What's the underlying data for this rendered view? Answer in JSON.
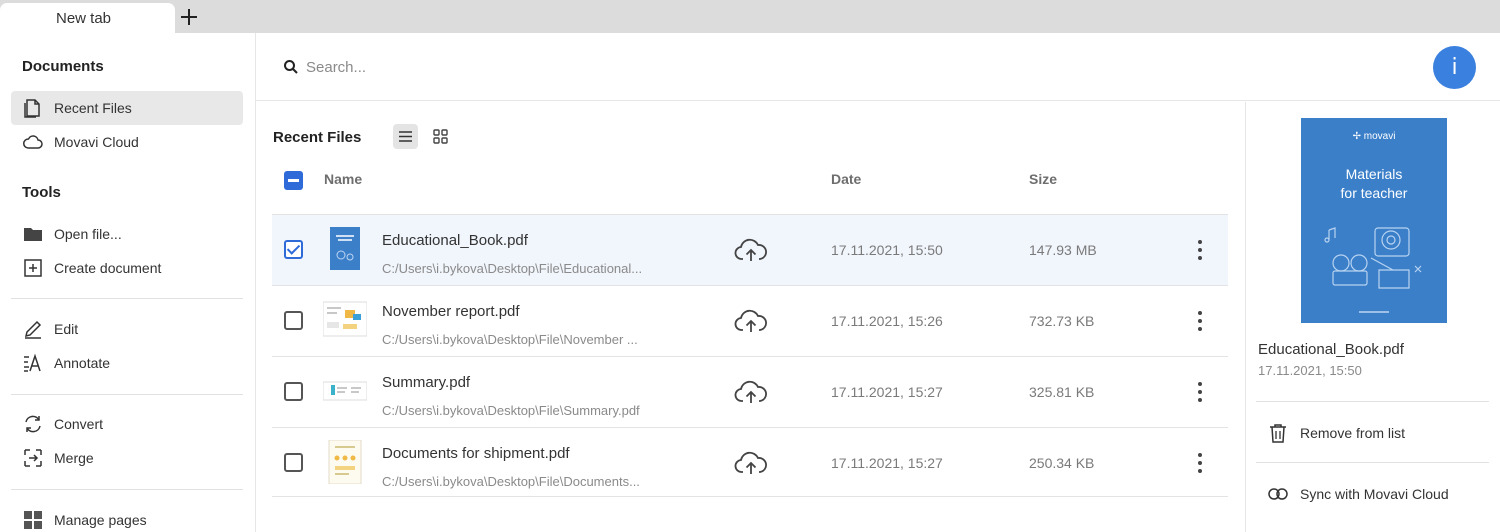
{
  "tabbar": {
    "tab_label": "New tab"
  },
  "sidebar": {
    "documents_title": "Documents",
    "tools_title": "Tools",
    "items": [
      {
        "label": "Recent Files",
        "icon": "recent-files-icon",
        "active": true
      },
      {
        "label": "Movavi Cloud",
        "icon": "cloud-icon"
      },
      {
        "label": "Open file...",
        "icon": "folder-icon"
      },
      {
        "label": "Create document",
        "icon": "create-document-icon"
      },
      {
        "label": "Edit",
        "icon": "pencil-icon"
      },
      {
        "label": "Annotate",
        "icon": "annotate-icon"
      },
      {
        "label": "Convert",
        "icon": "convert-icon"
      },
      {
        "label": "Merge",
        "icon": "merge-icon"
      },
      {
        "label": "Manage pages",
        "icon": "manage-pages-icon"
      }
    ]
  },
  "search": {
    "placeholder": "Search..."
  },
  "info_button": {
    "label": "i"
  },
  "main": {
    "title": "Recent Files",
    "columns": {
      "name": "Name",
      "date": "Date",
      "size": "Size"
    },
    "files": [
      {
        "name": "Educational_Book.pdf",
        "path": "C:/Users\\i.bykova\\Desktop\\File\\Educational...",
        "date": "17.11.2021, 15:50",
        "size": "147.93 MB",
        "selected": true
      },
      {
        "name": "November report.pdf",
        "path": "C:/Users\\i.bykova\\Desktop\\File\\November ...",
        "date": "17.11.2021, 15:26",
        "size": "732.73 KB",
        "selected": false
      },
      {
        "name": "Summary.pdf",
        "path": "C:/Users\\i.bykova\\Desktop\\File\\Summary.pdf",
        "date": "17.11.2021, 15:27",
        "size": "325.81 KB",
        "selected": false
      },
      {
        "name": "Documents for shipment.pdf",
        "path": "C:/Users\\i.bykova\\Desktop\\File\\Documents...",
        "date": "17.11.2021, 15:27",
        "size": "250.34 KB",
        "selected": false
      }
    ]
  },
  "details": {
    "preview_logo": "✢ movavi",
    "preview_title_line1": "Materials",
    "preview_title_line2": "for teacher",
    "name": "Educational_Book.pdf",
    "date": "17.11.2021, 15:50",
    "remove_label": "Remove from list",
    "sync_label": "Sync with Movavi Cloud"
  },
  "colors": {
    "accent": "#2f6bd8",
    "info_button": "#3a80de",
    "preview_cover": "#3b7fc9",
    "selected_row": "#f1f5fc"
  }
}
